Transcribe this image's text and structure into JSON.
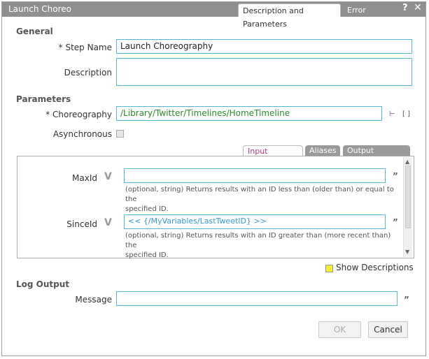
{
  "window": {
    "title": "Launch Choreo",
    "tabs": [
      "Description and Parameters",
      "Error Handling"
    ],
    "help_label": "?",
    "close_label": "✕"
  },
  "general": {
    "heading": "General",
    "step_name_label": "* Step Name",
    "step_name_value": "Launch Choreography",
    "description_label": "Description",
    "description_value": ""
  },
  "parameters": {
    "heading": "Parameters",
    "choreography_label": "* Choreography",
    "choreography_value": "/Library/Twitter/Timelines/HomeTimeline",
    "tree_icon_glyph": "⊢",
    "brackets_glyph": "[ ]",
    "asynchronous_label": "Asynchronous",
    "asynchronous_checked": false
  },
  "variable_tabs": [
    "Input Variables",
    "Aliases",
    "Output Variables"
  ],
  "variables": [
    {
      "name": "MaxId",
      "value": "",
      "description_line1": "(optional, string) Returns results with an ID less than (older than) or equal to the",
      "description_line2": "specified ID."
    },
    {
      "name": "SinceId",
      "value": "<< {/MyVariables/LastTweetID} >>",
      "description_line1": "(optional, string) Returns results with an ID greater than (more recent than) the",
      "description_line2": "specified ID."
    }
  ],
  "variable_glyph": "V",
  "quote_glyph": "”",
  "show_descriptions": {
    "label": "Show Descriptions",
    "color": "#f2ee32"
  },
  "log_output": {
    "heading": "Log Output",
    "message_label": "Message",
    "message_value": ""
  },
  "buttons": {
    "ok": "OK",
    "cancel": "Cancel"
  },
  "colors": {
    "titlebar": "#8f8f8f",
    "input_border": "#54b8d6",
    "path_text": "#2e8b2e",
    "active_tab_text": "#b03a7a",
    "variable_text": "#3a9ad9"
  }
}
